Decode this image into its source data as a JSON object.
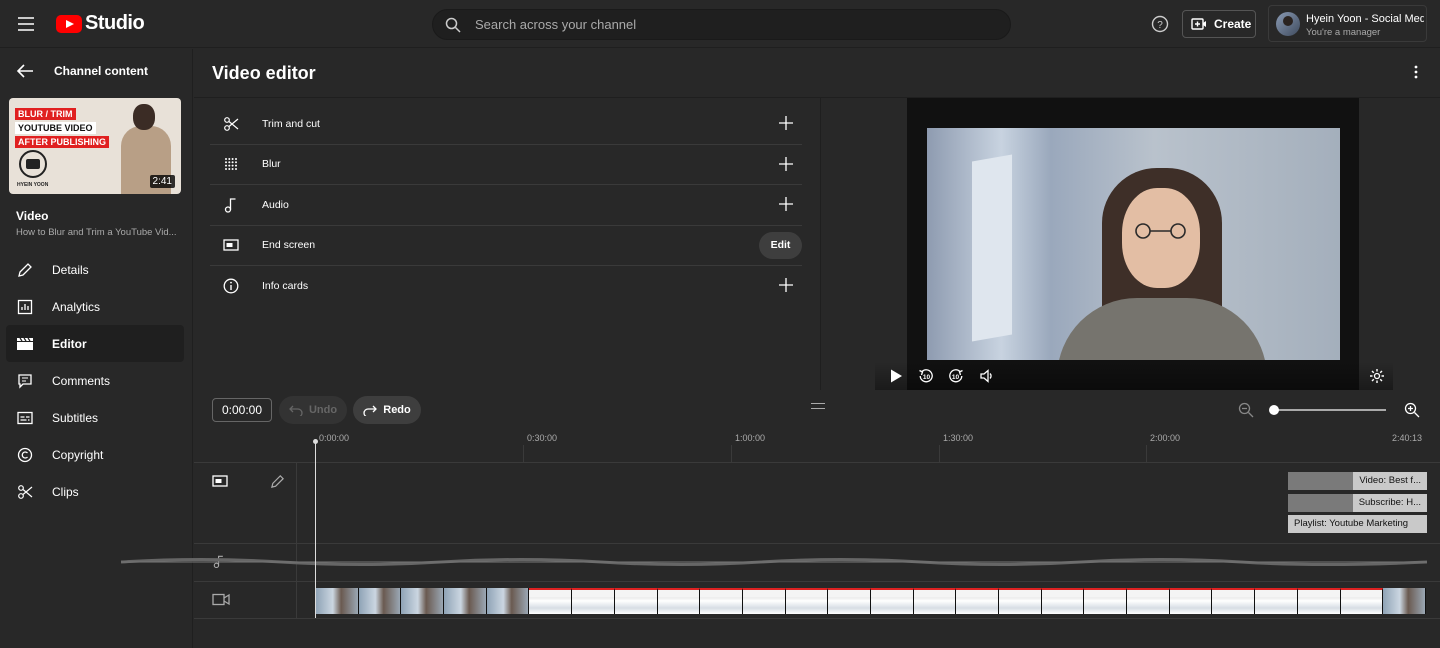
{
  "app": {
    "logo_text": "Studio",
    "brand_color": "#ff0000"
  },
  "search": {
    "placeholder": "Search across your channel"
  },
  "header": {
    "create_label": "Create",
    "account_name": "Hyein Yoon - Social Med...",
    "account_role": "You're a manager"
  },
  "sidebar": {
    "back_label": "Channel content",
    "thumbnail": {
      "line1": "BLUR / TRIM",
      "line2": "YOUTUBE VIDEO",
      "line3": "AFTER PUBLISHING",
      "author_tag": "HYEIN YOON",
      "duration": "2:41"
    },
    "video_label": "Video",
    "video_title": "How to Blur and Trim a YouTube Vid...",
    "items": [
      {
        "label": "Details",
        "icon": "pencil-icon"
      },
      {
        "label": "Analytics",
        "icon": "analytics-icon"
      },
      {
        "label": "Editor",
        "icon": "clapperboard-icon",
        "active": true
      },
      {
        "label": "Comments",
        "icon": "comment-icon"
      },
      {
        "label": "Subtitles",
        "icon": "subtitles-icon"
      },
      {
        "label": "Copyright",
        "icon": "copyright-icon"
      },
      {
        "label": "Clips",
        "icon": "scissors-icon"
      }
    ]
  },
  "editor": {
    "title": "Video editor",
    "tools": [
      {
        "label": "Trim and cut",
        "icon": "scissors-icon",
        "action": "plus"
      },
      {
        "label": "Blur",
        "icon": "blur-icon",
        "action": "plus"
      },
      {
        "label": "Audio",
        "icon": "music-note-icon",
        "action": "plus"
      },
      {
        "label": "End screen",
        "icon": "end-screen-icon",
        "action": "Edit"
      },
      {
        "label": "Info cards",
        "icon": "info-icon",
        "action": "plus"
      }
    ]
  },
  "timeline": {
    "current_time": "0:00:00",
    "undo_label": "Undo",
    "redo_label": "Redo",
    "ticks": [
      "0:00:00",
      "0:30:00",
      "1:00:00",
      "1:30:00",
      "2:00:00",
      "2:40:13"
    ],
    "end_screen_elements": [
      "Video: Best f...",
      "Subscribe: H...",
      "Playlist: Youtube Marketing"
    ]
  }
}
